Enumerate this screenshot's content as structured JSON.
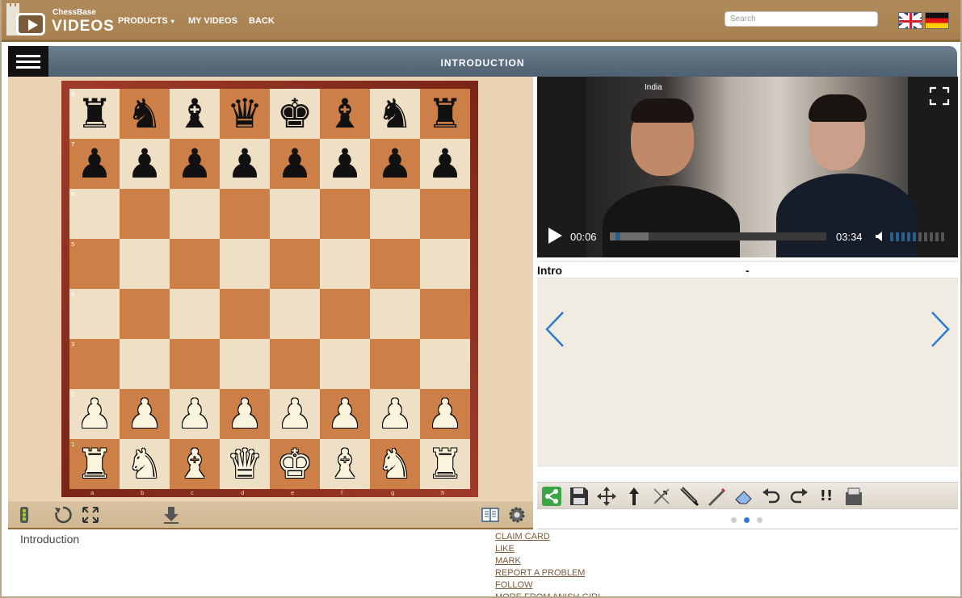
{
  "header": {
    "brand_small": "ChessBase",
    "brand_large": "VIDEOS",
    "nav": [
      {
        "label": "PRODUCTS",
        "has_dropdown": true
      },
      {
        "label": "MY VIDEOS"
      },
      {
        "label": "BACK"
      }
    ],
    "search_placeholder": "Search",
    "languages": [
      "flag-uk-icon",
      "flag-de-icon"
    ]
  },
  "title_bar": {
    "title": "INTRODUCTION",
    "menu_icon": "hamburger-icon"
  },
  "board": {
    "ranks": [
      "8",
      "7",
      "6",
      "5",
      "4",
      "3",
      "2",
      "1"
    ],
    "files": [
      "a",
      "b",
      "c",
      "d",
      "e",
      "f",
      "g",
      "h"
    ],
    "position": [
      [
        "♜",
        "♞",
        "♝",
        "♛",
        "♚",
        "♝",
        "♞",
        "♜"
      ],
      [
        "♟",
        "♟",
        "♟",
        "♟",
        "♟",
        "♟",
        "♟",
        "♟"
      ],
      [
        "",
        "",
        "",
        "",
        "",
        "",
        "",
        ""
      ],
      [
        "",
        "",
        "",
        "",
        "",
        "",
        "",
        ""
      ],
      [
        "",
        "",
        "",
        "",
        "",
        "",
        "",
        ""
      ],
      [
        "",
        "",
        "",
        "",
        "",
        "",
        "",
        ""
      ],
      [
        "♟",
        "♟",
        "♟",
        "♟",
        "♟",
        "♟",
        "♟",
        "♟"
      ],
      [
        "♜",
        "♞",
        "♝",
        "♛",
        "♚",
        "♝",
        "♞",
        "♜"
      ]
    ],
    "colors": {
      "light_square": "#efdfc4",
      "dark_square": "#cc7f47",
      "frame": "#8a2c1b"
    }
  },
  "board_toolbar": [
    "traffic-light-icon",
    "rotate-board-icon",
    "fullscreen-board-icon",
    "download-icon",
    "book-icon",
    "settings-icon"
  ],
  "video": {
    "badge": "India",
    "current_time": "00:06",
    "total_time": "03:34",
    "progress": 0.027,
    "volume_level": 0.45,
    "accent": "#2a5f8a"
  },
  "notation": {
    "chapter": "Intro",
    "separator": "-"
  },
  "tools": [
    "share-icon",
    "save-icon",
    "move-icon",
    "arrow-up-icon",
    "no-arrow-icon",
    "pen-icon",
    "pen2-icon",
    "eraser-icon",
    "undo-icon",
    "redo-icon",
    "annotation-icon",
    "clipboard-icon"
  ],
  "tools_labels": {
    "annotation": "!!"
  },
  "carousel": {
    "count": 3,
    "active": 1
  },
  "footer": {
    "description": "Introduction",
    "links": [
      "CLAIM CARD",
      "LIKE",
      "MARK",
      "REPORT A PROBLEM",
      "FOLLOW",
      "MORE FROM ANISH GIRI"
    ]
  }
}
